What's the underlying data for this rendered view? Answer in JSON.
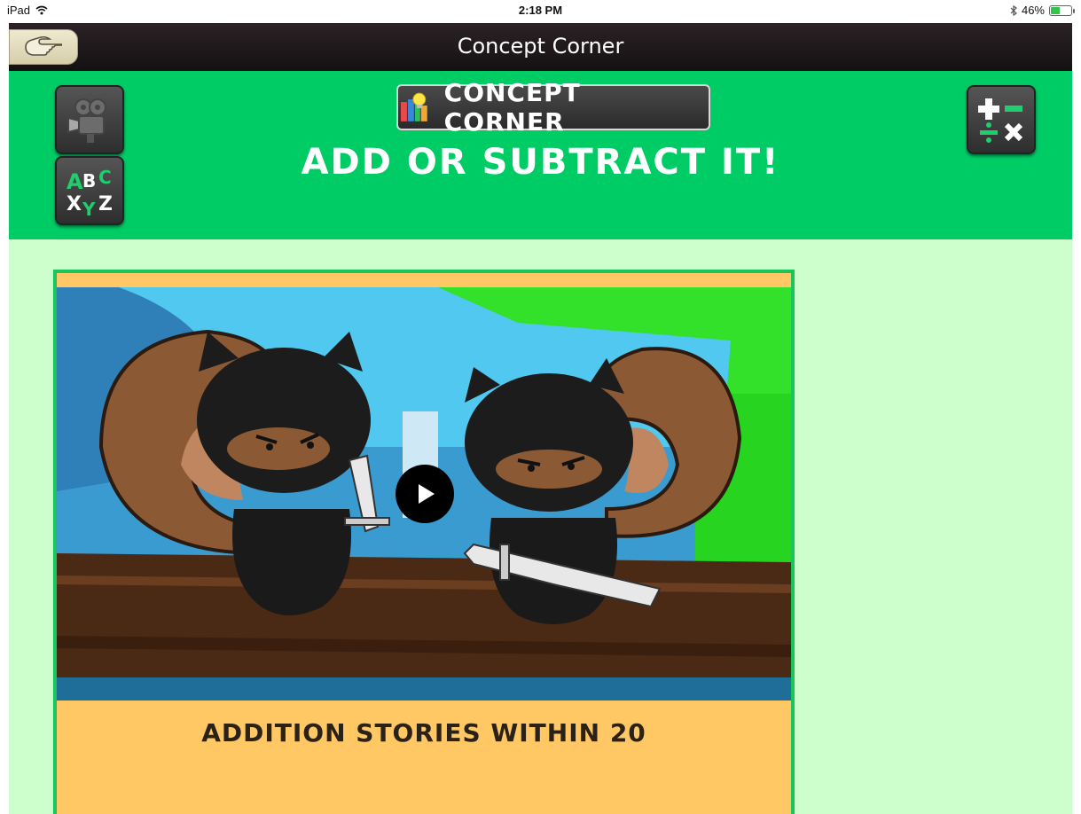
{
  "status_bar": {
    "device": "iPad",
    "time": "2:18 PM",
    "battery_percent": "46%",
    "battery_level": 0.46
  },
  "nav": {
    "title": "Concept Corner",
    "back_icon": "pointing-hand-icon"
  },
  "header": {
    "badge_label": "CONCEPT CORNER",
    "heading": "ADD OR SUBTRACT IT!",
    "left_buttons": [
      "video-camera-icon",
      "abc-xyz-icon"
    ],
    "right_button": "math-operators-icon"
  },
  "card": {
    "title": "ADDITION STORIES WITHIN 20",
    "play_icon": "play-icon"
  },
  "colors": {
    "header_green": "#00cc66",
    "content_bg": "#ccffcc",
    "card_bg": "#ffc865",
    "card_border": "#19c45b"
  }
}
